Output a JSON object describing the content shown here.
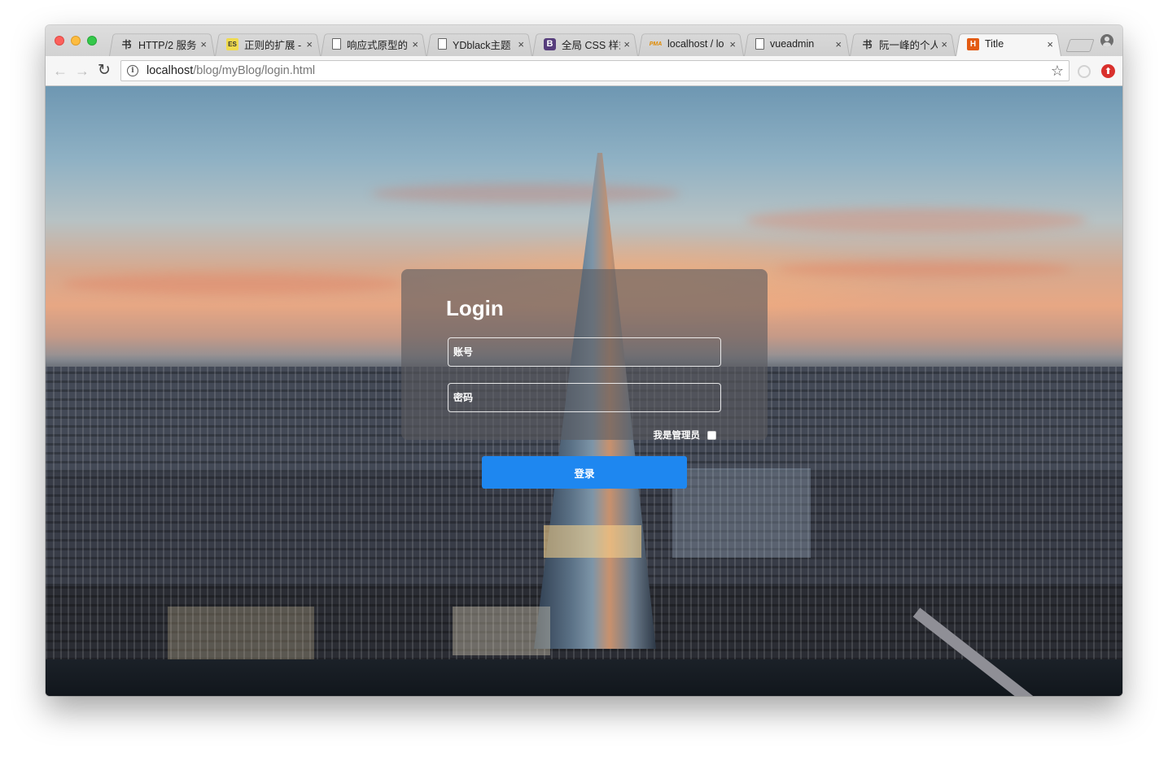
{
  "browser": {
    "tabs": [
      {
        "favicon": "jianshu-icon",
        "favicon_text": "书",
        "label": "HTTP/2 服务",
        "close": "×"
      },
      {
        "favicon": "es-icon",
        "favicon_text": "ES",
        "label": "正则的扩展 - ",
        "close": "×"
      },
      {
        "favicon": "document-icon",
        "favicon_text": "",
        "label": "响应式原型的",
        "close": "×"
      },
      {
        "favicon": "document-icon",
        "favicon_text": "",
        "label": "YDblack主题",
        "close": "×"
      },
      {
        "favicon": "bootstrap-icon",
        "favicon_text": "B",
        "label": "全局 CSS 样式",
        "close": "×"
      },
      {
        "favicon": "phpmyadmin-icon",
        "favicon_text": "PMA",
        "label": "localhost / lo",
        "close": "×"
      },
      {
        "favicon": "document-icon",
        "favicon_text": "",
        "label": "vueadmin",
        "close": "×"
      },
      {
        "favicon": "jianshu-icon",
        "favicon_text": "书",
        "label": "阮一峰的个人",
        "close": "×"
      },
      {
        "favicon": "title-page-icon",
        "favicon_text": "H",
        "label": "Title",
        "close": "×",
        "active": true
      }
    ],
    "address": {
      "host": "localhost",
      "path": "/blog/myBlog/login.html"
    },
    "nav": {
      "back": "←",
      "forward": "→",
      "reload": "↻"
    },
    "star": "☆",
    "ext2": "⬆"
  },
  "login": {
    "title": "Login",
    "account_placeholder": "账号",
    "password_placeholder": "密码",
    "admin_label": "我是管理员",
    "submit_label": "登录"
  },
  "colors": {
    "accent": "#1e87f0"
  }
}
